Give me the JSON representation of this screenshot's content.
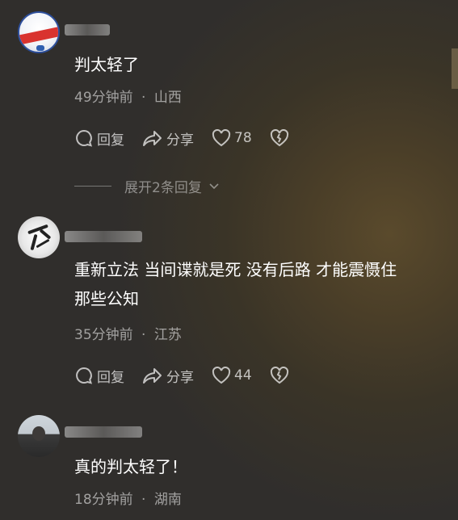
{
  "comments": [
    {
      "text": "判太轻了",
      "time": "49分钟前",
      "location": "山西",
      "reply_label": "回复",
      "share_label": "分享",
      "likes": "78",
      "expand_replies": "展开2条回复"
    },
    {
      "text_line1": "重新立法 当间谍就是死 没有后路 才能震慑住",
      "text_line2": "那些公知",
      "time": "35分钟前",
      "location": "江苏",
      "reply_label": "回复",
      "share_label": "分享",
      "likes": "44"
    },
    {
      "text": "真的判太轻了！",
      "time": "18分钟前",
      "location": "湖南"
    }
  ],
  "separator": "·"
}
